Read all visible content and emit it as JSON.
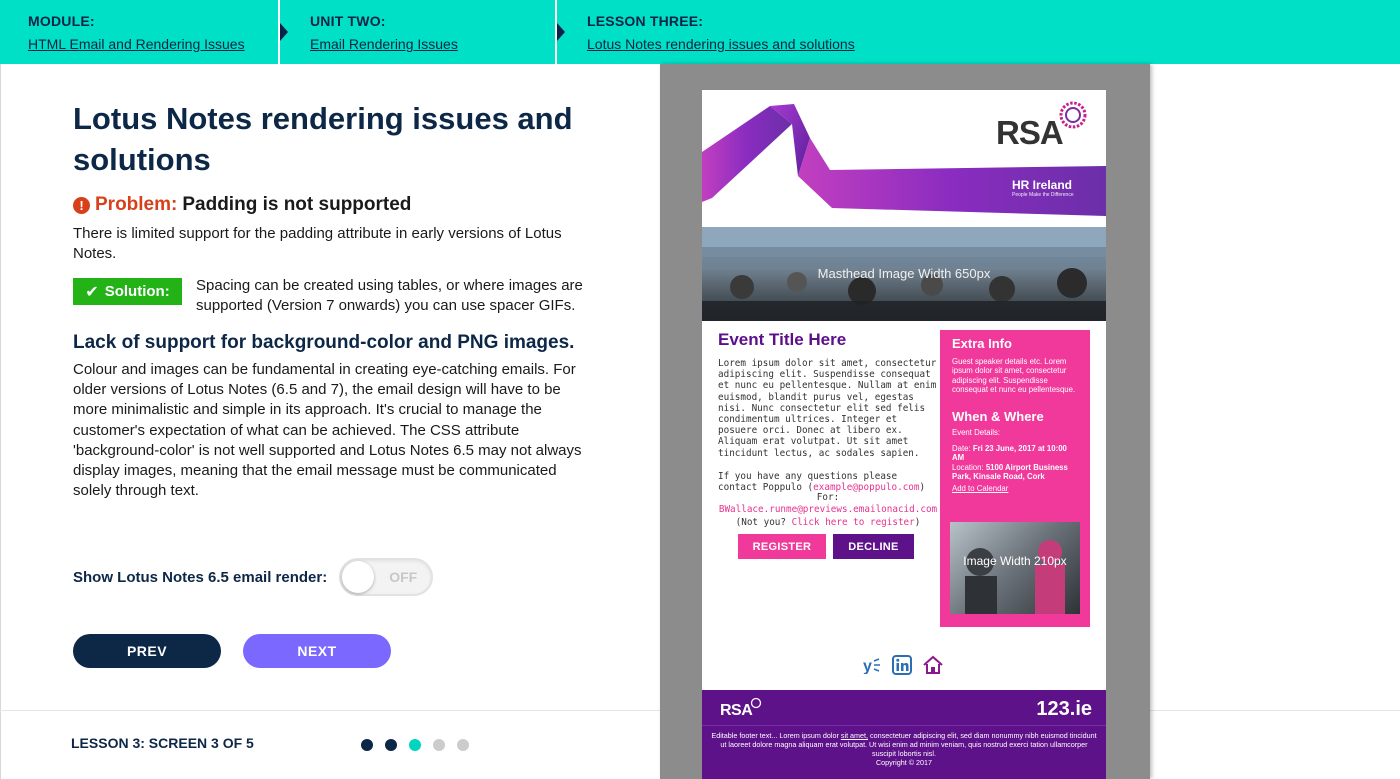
{
  "breadcrumb": {
    "module": {
      "label": "MODULE:",
      "link": "HTML Email and Rendering Issues"
    },
    "unit": {
      "label": "UNIT TWO:",
      "link": "Email Rendering Issues"
    },
    "lesson": {
      "label": "LESSON THREE:",
      "link": "Lotus Notes rendering issues and solutions"
    }
  },
  "lesson": {
    "title": "Lotus Notes rendering issues and solutions",
    "problem_word": "Problem:",
    "problem_text": "Padding is not supported",
    "problem_desc": "There is limited support for the padding attribute in early versions of Lotus Notes.",
    "solution_label": "Solution:",
    "solution_text": "Spacing can be created using tables, or where images are supported (Version 7 onwards) you can use spacer GIFs.",
    "section_heading": "Lack of support for background-color and PNG images.",
    "section_text": "Colour and images can be fundamental in creating eye-catching emails. For older versions of Lotus Notes (6.5 and 7), the email design will have to be more minimalistic and simple in its approach. It's crucial to manage the customer's expectation of what can be achieved. The CSS attribute 'background-color' is not well supported and Lotus Notes 6.5 may not always display images, meaning that the email message must be communicated solely through text."
  },
  "toggle": {
    "label": "Show Lotus Notes 6.5 email render:",
    "state": "OFF"
  },
  "nav": {
    "prev": "PREV",
    "next": "NEXT"
  },
  "footer": {
    "screen_label": "LESSON 3: SCREEN 3 OF 5",
    "dots": [
      {
        "state": "done",
        "color": "#0d2747"
      },
      {
        "state": "done",
        "color": "#0d2747"
      },
      {
        "state": "current",
        "color": "#00d5c0"
      },
      {
        "state": "todo",
        "color": "#cccccc"
      },
      {
        "state": "todo",
        "color": "#cccccc"
      }
    ]
  },
  "email": {
    "logo": "RSA",
    "hr_brand": "HR Ireland",
    "hr_tagline": "People Make the Difference",
    "masthead_text": "Masthead Image Width 650px",
    "event_title": "Event Title Here",
    "event_body": "Lorem ipsum dolor sit amet, consectetur adipiscing elit. Suspendisse consequat et nunc eu pellentesque. Nullam at enim euismod, blandit purus vel, egestas nisi. Nunc consectetur elit sed felis condimentum ultrices. Integer et posuere orci. Donec at libero ex. Aliquam erat volutpat. Ut sit amet tincidunt lectus, ac sodales sapien.",
    "ask_text": "If you have any questions please contact Poppulo (",
    "ask_email": "example@poppulo.com",
    "ask_close": ")",
    "for_label": "For:",
    "for_email": "BWallace.runme@previews.emailonacid.com",
    "not_you_pre": "(Not you? ",
    "not_you_link": "Click here to register",
    "not_you_post": ")",
    "register_btn": "REGISTER",
    "decline_btn": "DECLINE",
    "extra_title": "Extra Info",
    "extra_text": "Guest speaker details etc. Lorem ipsum dolor sit amet, consectetur adipiscing elit. Suspendisse consequat et nunc eu pellentesque.",
    "when_title": "When & Where",
    "event_details_label": "Event Details:",
    "date_label": "Date: ",
    "date_value": "Fri 23 June, 2017 at 10:00 AM",
    "location_label": "Location: ",
    "location_value": "5100 Airport Business Park, Kinsale Road, Cork",
    "add_calendar": "Add to Calendar",
    "side_image_text": "Image Width 210px",
    "footer_logo": "RSA",
    "footer_brand": "123.ie",
    "footer_text_pre": "Editable footer text... Lorem ipsum dolor ",
    "footer_text_link": "sit amet,",
    "footer_text_post": " consectetuer adipiscing elit, sed diam nonummy nibh euismod tincidunt ut laoreet dolore magna aliquam erat volutpat. Ut wisi enim ad minim veniam, quis nostrud exerci tation ullamcorper suscipit lobortis nisl.",
    "copyright": "Copyright © 2017",
    "social_icons": [
      "yammer-icon",
      "linkedin-icon",
      "home-icon"
    ]
  },
  "colors": {
    "topbar": "#00e0c6",
    "navy": "#0d2747",
    "next_btn": "#7b68ff",
    "problem_red": "#d8401c",
    "solution_green": "#23b317",
    "email_purple": "#5e1289",
    "email_pink": "#f0399b"
  }
}
